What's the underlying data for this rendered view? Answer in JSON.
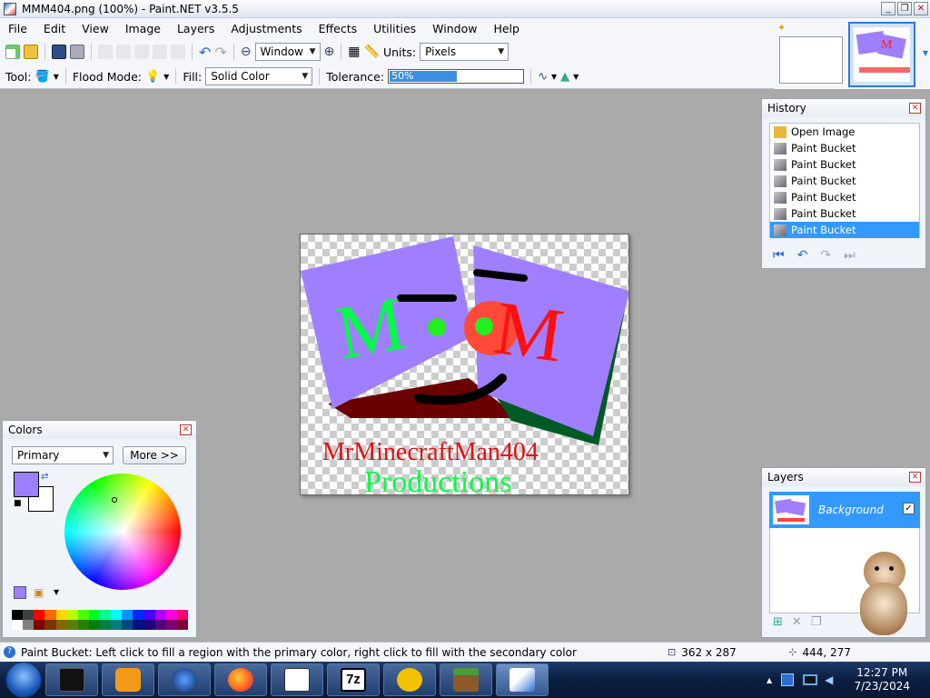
{
  "window": {
    "title": "MMM404.png (100%) - Paint.NET v3.5.5",
    "buttons": [
      "_",
      "❐",
      "✕"
    ]
  },
  "menu": [
    "File",
    "Edit",
    "View",
    "Image",
    "Layers",
    "Adjustments",
    "Effects",
    "Utilities",
    "Window",
    "Help"
  ],
  "toolbar": {
    "zoom_value": "Window",
    "units_label": "Units:",
    "units_value": "Pixels",
    "tool_label": "Tool:",
    "flood_label": "Flood Mode:",
    "fill_label": "Fill:",
    "fill_value": "Solid Color",
    "tolerance_label": "Tolerance:",
    "tolerance_value": "50%",
    "tolerance_fraction": 0.5
  },
  "canvas": {
    "line1": "MrMinecraftMan404",
    "line2": "Productions",
    "letter_left": "M",
    "letter_right": "M",
    "colors": {
      "purple": "#9f7fff",
      "green": "#00ff44",
      "red": "#ff2020",
      "darkred": "#6b0000",
      "darkgreen": "#005a26"
    }
  },
  "history": {
    "title": "History",
    "items": [
      {
        "label": "Open Image",
        "selected": false
      },
      {
        "label": "Paint Bucket",
        "selected": false
      },
      {
        "label": "Paint Bucket",
        "selected": false
      },
      {
        "label": "Paint Bucket",
        "selected": false
      },
      {
        "label": "Paint Bucket",
        "selected": false
      },
      {
        "label": "Paint Bucket",
        "selected": false
      },
      {
        "label": "Paint Bucket",
        "selected": true
      }
    ]
  },
  "colors_panel": {
    "title": "Colors",
    "mode": "Primary",
    "more_button": "More >>",
    "primary_color": "#9b7fff",
    "secondary_color": "#ffffff",
    "palette": [
      "#000000",
      "#404040",
      "#ff0000",
      "#ff6a00",
      "#ffd800",
      "#b6ff00",
      "#4cff00",
      "#00ff21",
      "#00ff90",
      "#00ffff",
      "#0094ff",
      "#0026ff",
      "#4800ff",
      "#b200ff",
      "#ff00dc",
      "#ff006e",
      "#ffffff",
      "#808080",
      "#7f0000",
      "#7f3300",
      "#7f6a00",
      "#5b7f00",
      "#267f00",
      "#007f0e",
      "#007f46",
      "#007f7f",
      "#004a7f",
      "#00137f",
      "#21007f",
      "#57007f",
      "#7f006e",
      "#7f0037"
    ]
  },
  "layers": {
    "title": "Layers",
    "items": [
      {
        "name": "Background",
        "visible": true
      }
    ]
  },
  "status": {
    "hint": "Paint Bucket: Left click to fill a region with the primary color, right click to fill with the secondary color",
    "size": "362 x 287",
    "cursor": "444, 277"
  },
  "taskbar": {
    "time": "12:27 PM",
    "date": "7/23/2024",
    "apps": [
      "black-app",
      "media-player",
      "globe",
      "firefox",
      "solitaire",
      "7-zip",
      "zoom-app",
      "minecraft",
      "paint-net"
    ],
    "sevenzip_label": "7z"
  }
}
